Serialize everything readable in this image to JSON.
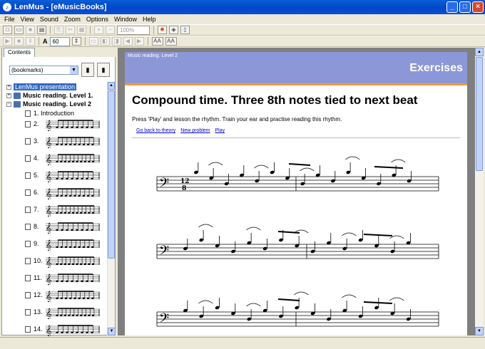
{
  "window": {
    "title": "LenMus - [eMusicBooks]"
  },
  "menu": [
    "File",
    "View",
    "Sound",
    "Zoom",
    "Options",
    "Window",
    "Help"
  ],
  "toolbar": {
    "zoom_value": "100%",
    "tempo_value": "60",
    "tempo_label": "A",
    "font_buttons": [
      "AA",
      "AA"
    ]
  },
  "sidebar": {
    "tab_label": "Contents",
    "bookmarks_value": "(bookmarks)",
    "tree": {
      "root": "LenMus presentation",
      "level1": "Music reading. Level 1.",
      "level2": "Music reading. Level 2",
      "intro": "1. Introduction",
      "items": [
        "2.",
        "3.",
        "4.",
        "5.",
        "6.",
        "7.",
        "8.",
        "9.",
        "10.",
        "11.",
        "12.",
        "13.",
        "14."
      ]
    }
  },
  "doc": {
    "header_small": "Music reading. Level 2",
    "header_big": "Exercises",
    "title": "Compound time. Three 8th notes tied to next beat",
    "description": "Press 'Play' and lesson the rhythm. Train your ear and practise reading this rhythm.",
    "links": [
      "Go back to theory",
      "New problem",
      "Play"
    ],
    "time_signature_top": "12",
    "time_signature_bottom": "8"
  }
}
